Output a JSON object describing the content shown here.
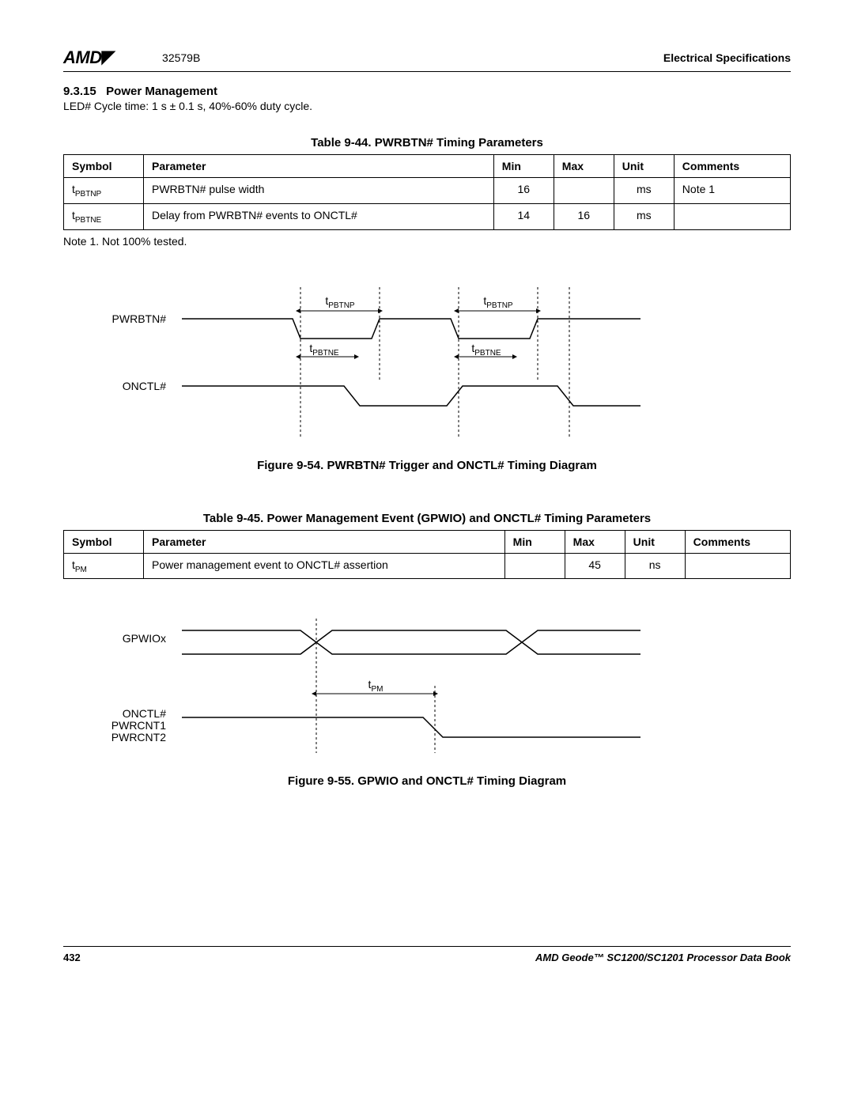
{
  "header": {
    "logo": "AMD",
    "doc_code": "32579B",
    "right": "Electrical Specifications"
  },
  "section": {
    "number": "9.3.15",
    "title": "Power Management",
    "body": "LED# Cycle time: 1 s ± 0.1 s, 40%-60% duty cycle."
  },
  "table44": {
    "caption": "Table 9-44.  PWRBTN# Timing Parameters",
    "headers": {
      "symbol": "Symbol",
      "parameter": "Parameter",
      "min": "Min",
      "max": "Max",
      "unit": "Unit",
      "comments": "Comments"
    },
    "rows": [
      {
        "symbol_base": "t",
        "symbol_sub": "PBTNP",
        "parameter": "PWRBTN# pulse width",
        "min": "16",
        "max": "",
        "unit": "ms",
        "comments": "Note 1"
      },
      {
        "symbol_base": "t",
        "symbol_sub": "PBTNE",
        "parameter": "Delay from PWRBTN# events to ONCTL#",
        "min": "14",
        "max": "16",
        "unit": "ms",
        "comments": ""
      }
    ],
    "footnote": "Note 1.   Not 100% tested."
  },
  "figure54": {
    "caption": "Figure 9-54.  PWRBTN# Trigger and ONCTL# Timing Diagram",
    "labels": {
      "pwrbtn": "PWRBTN#",
      "onctl": "ONCTL#",
      "tpbtnp": "PBTNP",
      "tpbtne": "PBTNE",
      "t": "t"
    }
  },
  "table45": {
    "caption": "Table 9-45.  Power Management Event (GPWIO) and ONCTL# Timing Parameters",
    "headers": {
      "symbol": "Symbol",
      "parameter": "Parameter",
      "min": "Min",
      "max": "Max",
      "unit": "Unit",
      "comments": "Comments"
    },
    "rows": [
      {
        "symbol_base": "t",
        "symbol_sub": "PM",
        "parameter": "Power management event to ONCTL# assertion",
        "min": "",
        "max": "45",
        "unit": "ns",
        "comments": ""
      }
    ]
  },
  "figure55": {
    "caption": "Figure 9-55.  GPWIO and ONCTL# Timing Diagram",
    "labels": {
      "gpwiox": "GPWIOx",
      "onctl": "ONCTL#",
      "pwrcnt1": "PWRCNT1",
      "pwrcnt2": "PWRCNT2",
      "tpm": "PM",
      "t": "t"
    }
  },
  "footer": {
    "page": "432",
    "right": "AMD Geode™ SC1200/SC1201 Processor Data Book"
  }
}
